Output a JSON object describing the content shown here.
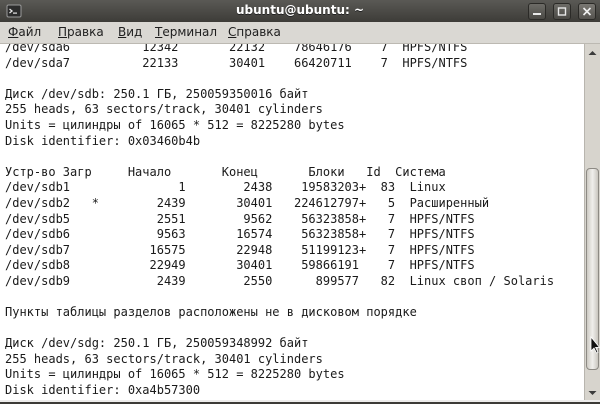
{
  "window": {
    "title": "ubuntu@ubuntu: ~",
    "icon": "terminal-icon",
    "controls": [
      "minimize-icon",
      "maximize-icon",
      "close-icon"
    ]
  },
  "menu": {
    "items": [
      {
        "label": "Файл",
        "mnemonic": "Ф",
        "rest": "айл"
      },
      {
        "label": "Правка",
        "mnemonic": "П",
        "rest": "равка"
      },
      {
        "label": "Вид",
        "mnemonic": "В",
        "rest": "ид"
      },
      {
        "label": "Терминал",
        "mnemonic": "Т",
        "rest": "ерминал"
      },
      {
        "label": "Справка",
        "mnemonic": "С",
        "rest": "правка"
      }
    ]
  },
  "terminal": {
    "lines": [
      "/dev/sda6          12342       22132    78646176    7  HPFS/NTFS",
      "/dev/sda7          22133       30401    66420711    7  HPFS/NTFS",
      "",
      "Диск /dev/sdb: 250.1 ГБ, 250059350016 байт",
      "255 heads, 63 sectors/track, 30401 cylinders",
      "Units = цилиндры of 16065 * 512 = 8225280 bytes",
      "Disk identifier: 0x03460b4b",
      "",
      "Устр-во Загр     Начало       Конец       Блоки   Id  Система",
      "/dev/sdb1               1        2438    19583203+  83  Linux",
      "/dev/sdb2   *        2439       30401   224612797+   5  Расширенный",
      "/dev/sdb5            2551        9562    56323858+   7  HPFS/NTFS",
      "/dev/sdb6            9563       16574    56323858+   7  HPFS/NTFS",
      "/dev/sdb7           16575       22948    51199123+   7  HPFS/NTFS",
      "/dev/sdb8           22949       30401    59866191    7  HPFS/NTFS",
      "/dev/sdb9            2439        2550      899577   82  Linux своп / Solaris",
      "",
      "Пункты таблицы разделов расположены не в дисковом порядке",
      "",
      "Диск /dev/sdg: 250.1 ГБ, 250059348992 байт",
      "255 heads, 63 sectors/track, 30401 cylinders",
      "Units = цилиндры of 16065 * 512 = 8225280 bytes",
      "Disk identifier: 0xa4b57300"
    ]
  },
  "scrollbar": {
    "position_fraction": 0.88,
    "thumb_fraction": 0.62,
    "icons": [
      "scroll-up-arrow-icon",
      "scroll-down-arrow-icon"
    ]
  }
}
